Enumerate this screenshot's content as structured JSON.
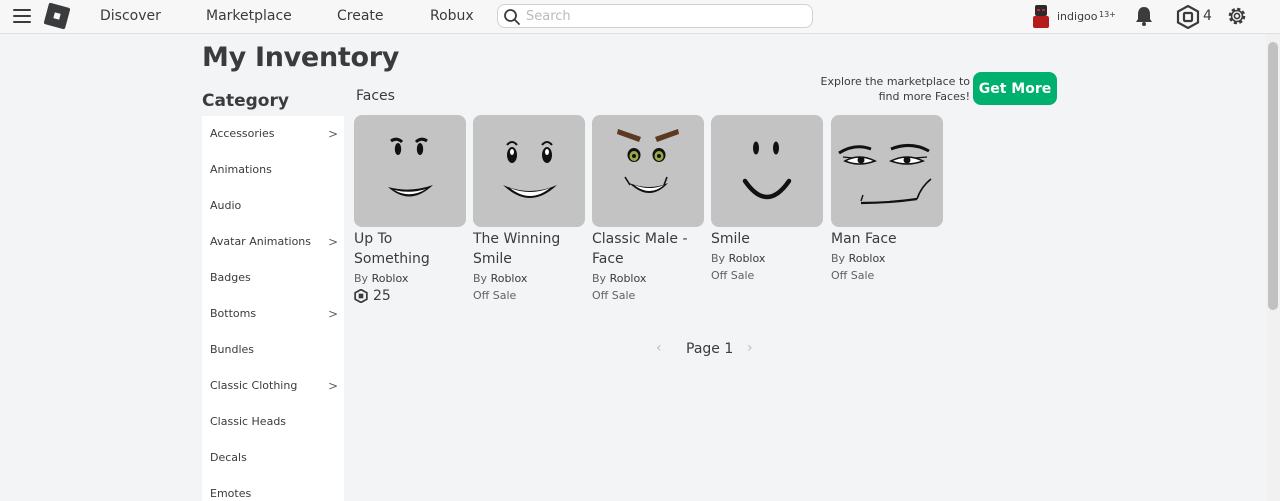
{
  "nav": {
    "links": [
      "Discover",
      "Marketplace",
      "Create",
      "Robux"
    ],
    "search_placeholder": "Search",
    "username": "indigoo",
    "age_badge": "13+",
    "robux_count": "4"
  },
  "page": {
    "title": "My Inventory",
    "category_title": "Category",
    "section_title": "Faces",
    "explore_text_1": "Explore the marketplace to",
    "explore_text_2": "find more Faces!",
    "get_more_label": "Get More"
  },
  "categories": [
    {
      "label": "Accessories",
      "chevron": ">"
    },
    {
      "label": "Animations",
      "chevron": ""
    },
    {
      "label": "Audio",
      "chevron": ""
    },
    {
      "label": "Avatar Animations",
      "chevron": ">"
    },
    {
      "label": "Badges",
      "chevron": ""
    },
    {
      "label": "Bottoms",
      "chevron": ">"
    },
    {
      "label": "Bundles",
      "chevron": ""
    },
    {
      "label": "Classic Clothing",
      "chevron": ">"
    },
    {
      "label": "Classic Heads",
      "chevron": ""
    },
    {
      "label": "Decals",
      "chevron": ""
    },
    {
      "label": "Emotes",
      "chevron": ""
    }
  ],
  "items": [
    {
      "name_1": "Up To",
      "name_2": "Something",
      "by": "By ",
      "creator": "Roblox",
      "price": "25",
      "face_icon": "up-to-something-face-icon"
    },
    {
      "name_1": "The Winning",
      "name_2": "Smile",
      "by": "By ",
      "creator": "Roblox",
      "price": "Off Sale",
      "face_icon": "winning-smile-face-icon"
    },
    {
      "name_1": "Classic Male -",
      "name_2": "Face",
      "by": "By ",
      "creator": "Roblox",
      "price": "Off Sale",
      "face_icon": "classic-male-face-icon"
    },
    {
      "name_1": "Smile",
      "name_2": "",
      "by": "By ",
      "creator": "Roblox",
      "price": "Off Sale",
      "face_icon": "smile-face-icon"
    },
    {
      "name_1": "Man Face",
      "name_2": "",
      "by": "By ",
      "creator": "Roblox",
      "price": "Off Sale",
      "face_icon": "man-face-icon"
    }
  ],
  "pager": {
    "prev": "‹",
    "label": "Page 1",
    "next": "›"
  },
  "colors": {
    "accent_green": "#00b06f",
    "text": "#393b3d",
    "thumb_bg": "#c3c3c3"
  }
}
